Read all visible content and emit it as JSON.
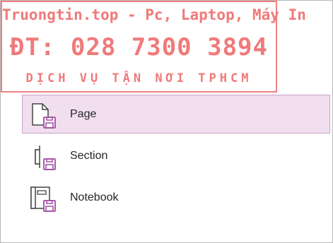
{
  "watermark": {
    "line1": "Truongtin.top - Pc, Laptop, Máy In",
    "line2": "ĐT: 028 7300 3894",
    "line3": "DỊCH VỤ TẬN NƠI TPHCM"
  },
  "options": [
    {
      "label": "Page",
      "icon": "page-save-icon",
      "selected": true
    },
    {
      "label": "Section",
      "icon": "section-save-icon",
      "selected": false
    },
    {
      "label": "Notebook",
      "icon": "notebook-save-icon",
      "selected": false
    }
  ],
  "colors": {
    "selected_bg": "#f1dff0",
    "selected_border": "#c8a2c6",
    "accent_purple": "#a24ba3",
    "watermark_red": "#f07a7a"
  }
}
